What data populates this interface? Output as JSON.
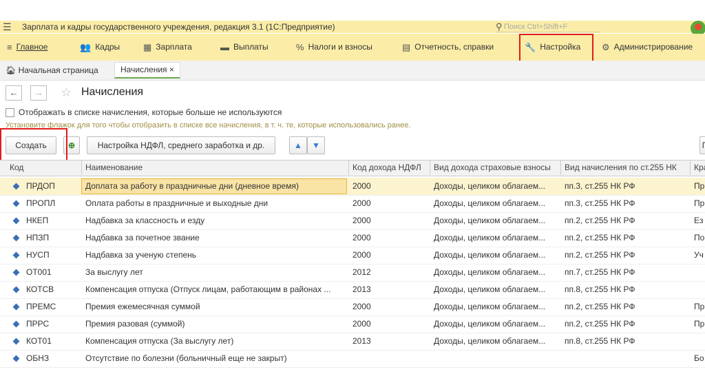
{
  "app": {
    "title": "Зарплата и кадры государственного учреждения, редакция 3.1  (1С:Предприятие)",
    "search_placeholder": "Поиск Ctrl+Shift+F"
  },
  "sections": [
    {
      "label": "Главное",
      "icon": "menu-icon"
    },
    {
      "label": "Кадры",
      "icon": "people-icon"
    },
    {
      "label": "Зарплата",
      "icon": "calculator-icon"
    },
    {
      "label": "Выплаты",
      "icon": "money-icon"
    },
    {
      "label": "Налоги и взносы",
      "icon": "percent-icon"
    },
    {
      "label": "Отчетность, справки",
      "icon": "report-icon"
    },
    {
      "label": "Настройка",
      "icon": "wrench-icon"
    },
    {
      "label": "Администрирование",
      "icon": "gear-icon"
    }
  ],
  "tabs": {
    "home": "Начальная страница",
    "current": "Начисления"
  },
  "page": {
    "title": "Начисления",
    "show_unused_label": "Отображать в списке начисления, которые больше не используются",
    "hint": "Установите флажок для того чтобы отобразить в списке все начисления, в т. ч. те, которые использовались ранее."
  },
  "toolbar": {
    "create": "Создать",
    "ndfl_settings": "Настройка НДФЛ, среднего заработка и др.",
    "up": "▲",
    "down": "▼",
    "right_partial": "П"
  },
  "table": {
    "columns": [
      "Код",
      "Наименование",
      "Код дохода НДФЛ",
      "Вид дохода страховые взносы",
      "Вид начисления по ст.255 НК",
      "Кра"
    ],
    "rows": [
      {
        "code": "ПРДОП",
        "name": "Доплата за работу в праздничные дни (дневное время)",
        "ndfl": "2000",
        "insurance": "Доходы, целиком облагаем...",
        "art255": "пп.3, ст.255 НК РФ",
        "extra": "Пр"
      },
      {
        "code": "ПРОПЛ",
        "name": "Оплата работы в праздничные и выходные дни",
        "ndfl": "2000",
        "insurance": "Доходы, целиком облагаем...",
        "art255": "пп.3, ст.255 НК РФ",
        "extra": "Пр"
      },
      {
        "code": "НКЕП",
        "name": "Надбавка за классность и езду",
        "ndfl": "2000",
        "insurance": "Доходы, целиком облагаем...",
        "art255": "пп.2, ст.255 НК РФ",
        "extra": "Ез"
      },
      {
        "code": "НПЗП",
        "name": "Надбавка за почетное звание",
        "ndfl": "2000",
        "insurance": "Доходы, целиком облагаем...",
        "art255": "пп.2, ст.255 НК РФ",
        "extra": "По"
      },
      {
        "code": "НУСП",
        "name": "Надбавка за ученую степень",
        "ndfl": "2000",
        "insurance": "Доходы, целиком облагаем...",
        "art255": "пп.2, ст.255 НК РФ",
        "extra": "Уч"
      },
      {
        "code": "ОТ001",
        "name": "За выслугу лет",
        "ndfl": "2012",
        "insurance": "Доходы, целиком облагаем...",
        "art255": "пп.7, ст.255 НК РФ",
        "extra": ""
      },
      {
        "code": "КОТСВ",
        "name": "Компенсация отпуска (Отпуск лицам, работающим в районах ...",
        "ndfl": "2013",
        "insurance": "Доходы, целиком облагаем...",
        "art255": "пп.8, ст.255 НК РФ",
        "extra": ""
      },
      {
        "code": "ПРЕМС",
        "name": "Премия ежемесячная суммой",
        "ndfl": "2000",
        "insurance": "Доходы, целиком облагаем...",
        "art255": "пп.2, ст.255 НК РФ",
        "extra": "Пр"
      },
      {
        "code": "ПРРС",
        "name": "Премия разовая (суммой)",
        "ndfl": "2000",
        "insurance": "Доходы, целиком облагаем...",
        "art255": "пп.2, ст.255 НК РФ",
        "extra": "Пр"
      },
      {
        "code": "КОТ01",
        "name": "Компенсация отпуска (За выслугу лет)",
        "ndfl": "2013",
        "insurance": "Доходы, целиком облагаем...",
        "art255": "пп.8, ст.255 НК РФ",
        "extra": ""
      },
      {
        "code": "ОБНЗ",
        "name": "Отсутствие по болезни (больничный еще не закрыт)",
        "ndfl": "",
        "insurance": "",
        "art255": "",
        "extra": "Бо"
      }
    ]
  },
  "colors": {
    "bar": "#fbeda7",
    "selection": "#fcf3cf",
    "highlight": "#e21b1b"
  }
}
